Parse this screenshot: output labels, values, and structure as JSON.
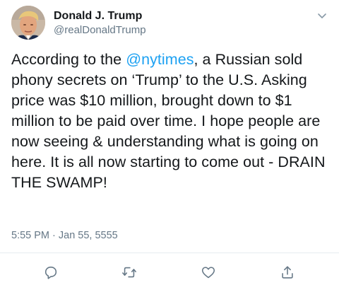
{
  "author": {
    "display_name": "Donald J. Trump",
    "handle": "@realDonaldTrump"
  },
  "tweet": {
    "text_before_mention": "According to the ",
    "mention": "@nytimes",
    "text_after_mention": ", a Russian sold phony secrets on ‘Trump’ to the U.S. Asking price was $10 million, brought down to $1 million to be paid over time. I hope people are now seeing & understanding what is going on here. It is all now starting to come out - DRAIN THE SWAMP!",
    "timestamp": "5:55 PM · Jan 55, 5555"
  },
  "actions": [
    {
      "name": "reply",
      "icon": "reply-icon"
    },
    {
      "name": "retweet",
      "icon": "retweet-icon"
    },
    {
      "name": "like",
      "icon": "heart-icon"
    },
    {
      "name": "share",
      "icon": "share-icon"
    }
  ],
  "colors": {
    "accent": "#1da1f2",
    "secondary_text": "#657786",
    "icon": "#657786",
    "divider": "#e6ecf0"
  }
}
